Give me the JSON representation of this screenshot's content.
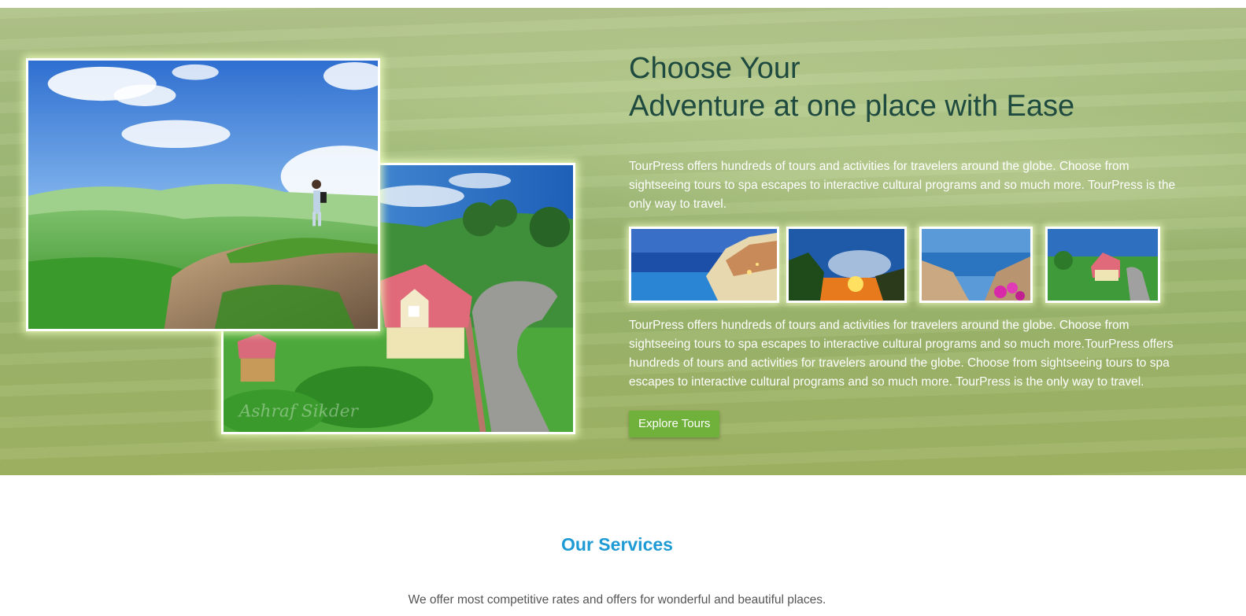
{
  "hero": {
    "heading_line1": "Choose Your",
    "heading_line2": "Adventure at one place with Ease",
    "paragraph1": "TourPress offers hundreds of tours and activities for travelers around the globe. Choose from sightseeing tours to spa escapes to interactive cultural programs and so much more. TourPress is the only way to travel.",
    "paragraph2": "TourPress offers hundreds of tours and activities for travelers around the globe. Choose from sightseeing tours to spa escapes to interactive cultural programs and so much more.TourPress offers hundreds of tours and activities for travelers around the globe. Choose from sightseeing tours to spa escapes to interactive cultural programs and so much more. TourPress is the only way to travel.",
    "button_label": "Explore Tours",
    "photo_watermark": "Ashraf Sikder"
  },
  "services": {
    "title": "Our Services",
    "subtitle": "We offer most competitive rates and offers for wonderful and beautiful places."
  },
  "colors": {
    "hero_bg": "#9db874",
    "heading": "#1f4a3f",
    "button": "#6fb13a",
    "services_title": "#1e9ad4"
  }
}
